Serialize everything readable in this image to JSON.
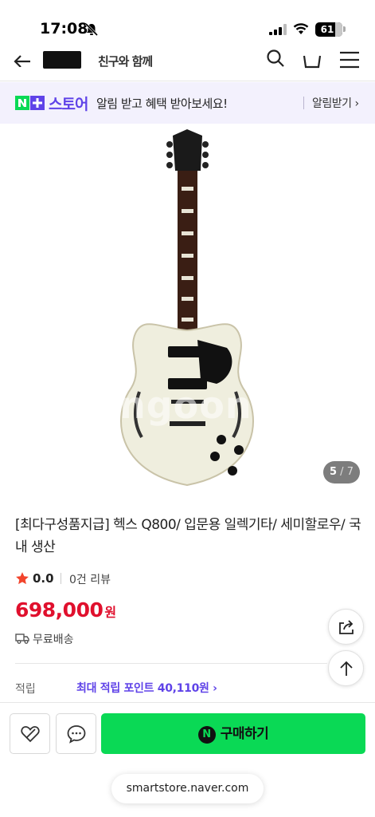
{
  "status_bar": {
    "time": "17:08",
    "battery": "61"
  },
  "top_nav": {
    "brand_sub": "친구와 함께"
  },
  "promo": {
    "store_name": "스토어",
    "message": "알림 받고 혜택 받아보세요!",
    "button": "알림받기 ›"
  },
  "gallery": {
    "current": "5",
    "separator": " / ",
    "total": "7",
    "watermark": "ngoon"
  },
  "product": {
    "title": "[최다구성품지급] 헥스 Q800/ 입문용 일렉기타/ 세미할로우/ 국내 생산",
    "rating": "0.0",
    "review_count": "0건 리뷰",
    "price": "698,000",
    "price_unit": "원",
    "shipping": "무료배송",
    "points_label": "적립",
    "points_value": "최대 적립 포인트 40,110원 ›"
  },
  "bottom_bar": {
    "buy_label": "구매하기",
    "n_badge": "N"
  },
  "browser": {
    "url": "smartstore.naver.com"
  },
  "colors": {
    "accent_purple": "#5f43e8",
    "price_red": "#e0102d",
    "naver_green": "#0ad955",
    "star_red": "#f2442c"
  }
}
